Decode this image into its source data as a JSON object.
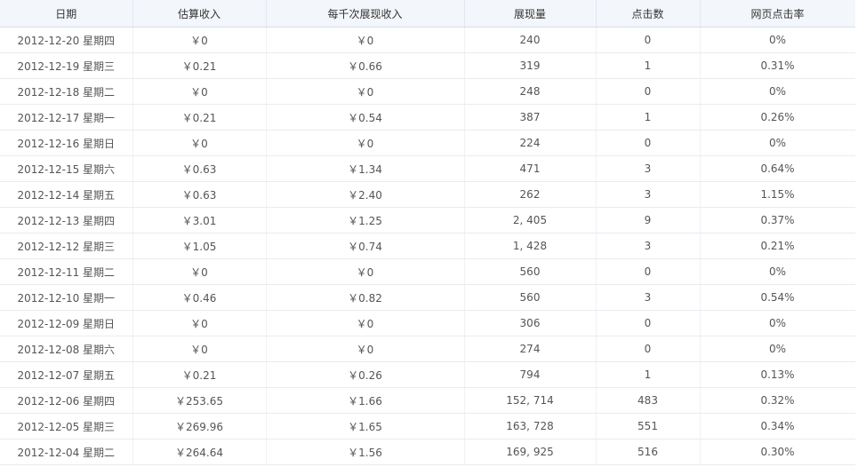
{
  "headers": [
    "日期",
    "估算收入",
    "每千次展现收入",
    "展现量",
    "点击数",
    "网页点击率"
  ],
  "rows": [
    [
      "2012-12-20 星期四",
      "￥0",
      "￥0",
      "240",
      "0",
      "0%"
    ],
    [
      "2012-12-19 星期三",
      "￥0.21",
      "￥0.66",
      "319",
      "1",
      "0.31%"
    ],
    [
      "2012-12-18 星期二",
      "￥0",
      "￥0",
      "248",
      "0",
      "0%"
    ],
    [
      "2012-12-17 星期一",
      "￥0.21",
      "￥0.54",
      "387",
      "1",
      "0.26%"
    ],
    [
      "2012-12-16 星期日",
      "￥0",
      "￥0",
      "224",
      "0",
      "0%"
    ],
    [
      "2012-12-15 星期六",
      "￥0.63",
      "￥1.34",
      "471",
      "3",
      "0.64%"
    ],
    [
      "2012-12-14 星期五",
      "￥0.63",
      "￥2.40",
      "262",
      "3",
      "1.15%"
    ],
    [
      "2012-12-13 星期四",
      "￥3.01",
      "￥1.25",
      "2, 405",
      "9",
      "0.37%"
    ],
    [
      "2012-12-12 星期三",
      "￥1.05",
      "￥0.74",
      "1, 428",
      "3",
      "0.21%"
    ],
    [
      "2012-12-11 星期二",
      "￥0",
      "￥0",
      "560",
      "0",
      "0%"
    ],
    [
      "2012-12-10 星期一",
      "￥0.46",
      "￥0.82",
      "560",
      "3",
      "0.54%"
    ],
    [
      "2012-12-09 星期日",
      "￥0",
      "￥0",
      "306",
      "0",
      "0%"
    ],
    [
      "2012-12-08 星期六",
      "￥0",
      "￥0",
      "274",
      "0",
      "0%"
    ],
    [
      "2012-12-07 星期五",
      "￥0.21",
      "￥0.26",
      "794",
      "1",
      "0.13%"
    ],
    [
      "2012-12-06 星期四",
      "￥253.65",
      "￥1.66",
      "152, 714",
      "483",
      "0.32%"
    ],
    [
      "2012-12-05 星期三",
      "￥269.96",
      "￥1.65",
      "163, 728",
      "551",
      "0.34%"
    ],
    [
      "2012-12-04 星期二",
      "￥264.64",
      "￥1.56",
      "169, 925",
      "516",
      "0.30%"
    ]
  ]
}
